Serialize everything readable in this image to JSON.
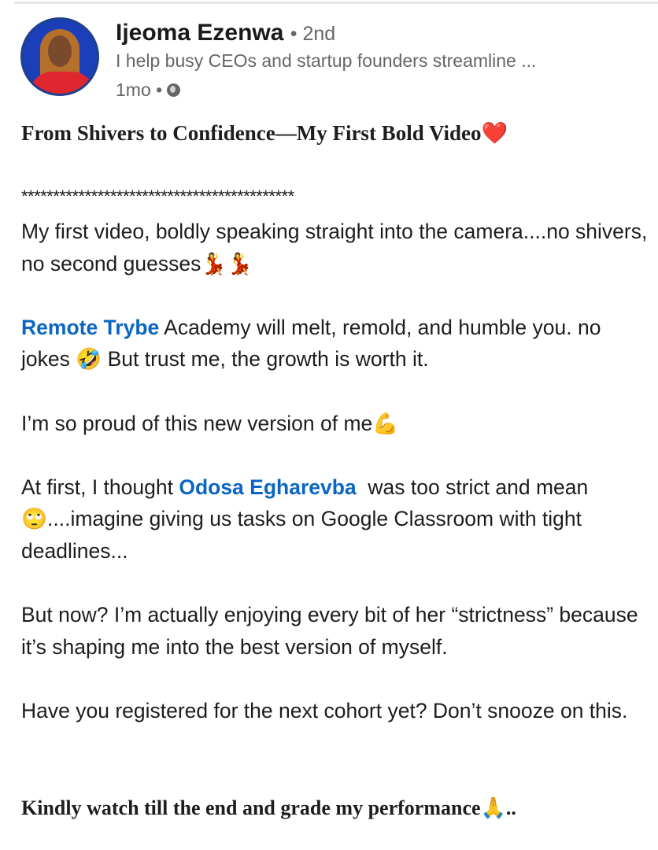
{
  "author": {
    "name": "Ijeoma Ezenwa",
    "degree": "• 2nd",
    "headline": "I help busy CEOs and startup founders streamline ...",
    "time": "1mo •",
    "visibility_icon": "globe-icon"
  },
  "post": {
    "title": "From Shivers to Confidence—My First Bold Video",
    "title_emoji": "❤️",
    "separator": "*******************************************",
    "p1": "My first video, boldly speaking straight into the camera....no shivers, no second guesses",
    "p1_emoji": "💃💃",
    "p2_link": "Remote Trybe",
    "p2_a": " Academy will melt, remold, and humble you. no jokes ",
    "p2_emoji": "🤣",
    "p2_b": " But trust me, the growth is worth it.",
    "p3": "I’m so proud of this new version of me",
    "p3_emoji": "💪",
    "p4_a": "At first, I thought ",
    "p4_link": "Odosa Egharevba",
    "p4_b": "  was too strict and mean",
    "p4_emoji": "🙄",
    "p4_c": "....imagine giving us tasks on Google Classroom with tight deadlines...",
    "p5": " But now? I’m actually enjoying every bit of her “strictness” because it’s shaping me into the best version of myself.",
    "p6": "Have you registered for the next cohort yet? Don’t snooze on this.",
    "closing": "Kindly watch till the end and grade my performance",
    "closing_emoji": "🙏",
    "closing_tail": ".."
  }
}
